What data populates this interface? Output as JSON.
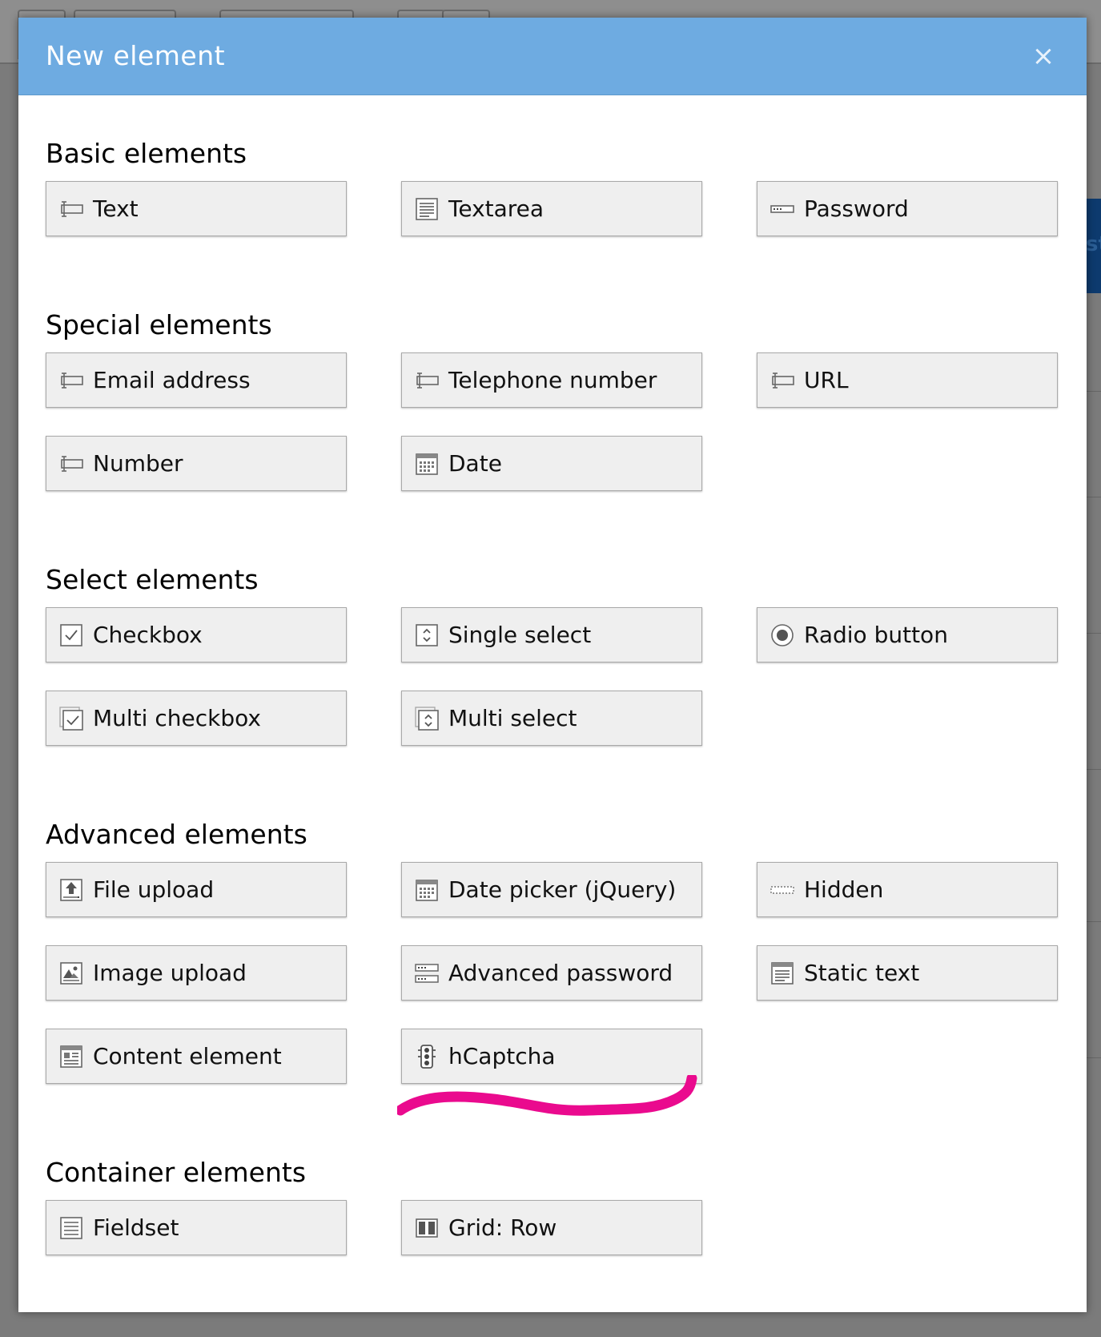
{
  "dialog": {
    "title": "New element",
    "close_label": "×"
  },
  "sections": {
    "basic": {
      "title": "Basic elements",
      "items": [
        "Text",
        "Textarea",
        "Password"
      ]
    },
    "special": {
      "title": "Special elements",
      "items": [
        "Email address",
        "Telephone number",
        "URL",
        "Number",
        "Date"
      ]
    },
    "select": {
      "title": "Select elements",
      "items": [
        "Checkbox",
        "Single select",
        "Radio button",
        "Multi checkbox",
        "Multi select"
      ]
    },
    "advanced": {
      "title": "Advanced elements",
      "items": [
        "File upload",
        "Date picker (jQuery)",
        "Hidden",
        "Image upload",
        "Advanced password",
        "Static text",
        "Content element",
        "hCaptcha"
      ]
    },
    "container": {
      "title": "Container elements",
      "items": [
        "Fieldset",
        "Grid: Row"
      ]
    }
  },
  "colors": {
    "header": "#6eabe1",
    "button_bg": "#efefef",
    "button_border": "#a9a9a9",
    "annotation": "#ea0a8e"
  },
  "background": {
    "partial_text": "st"
  }
}
